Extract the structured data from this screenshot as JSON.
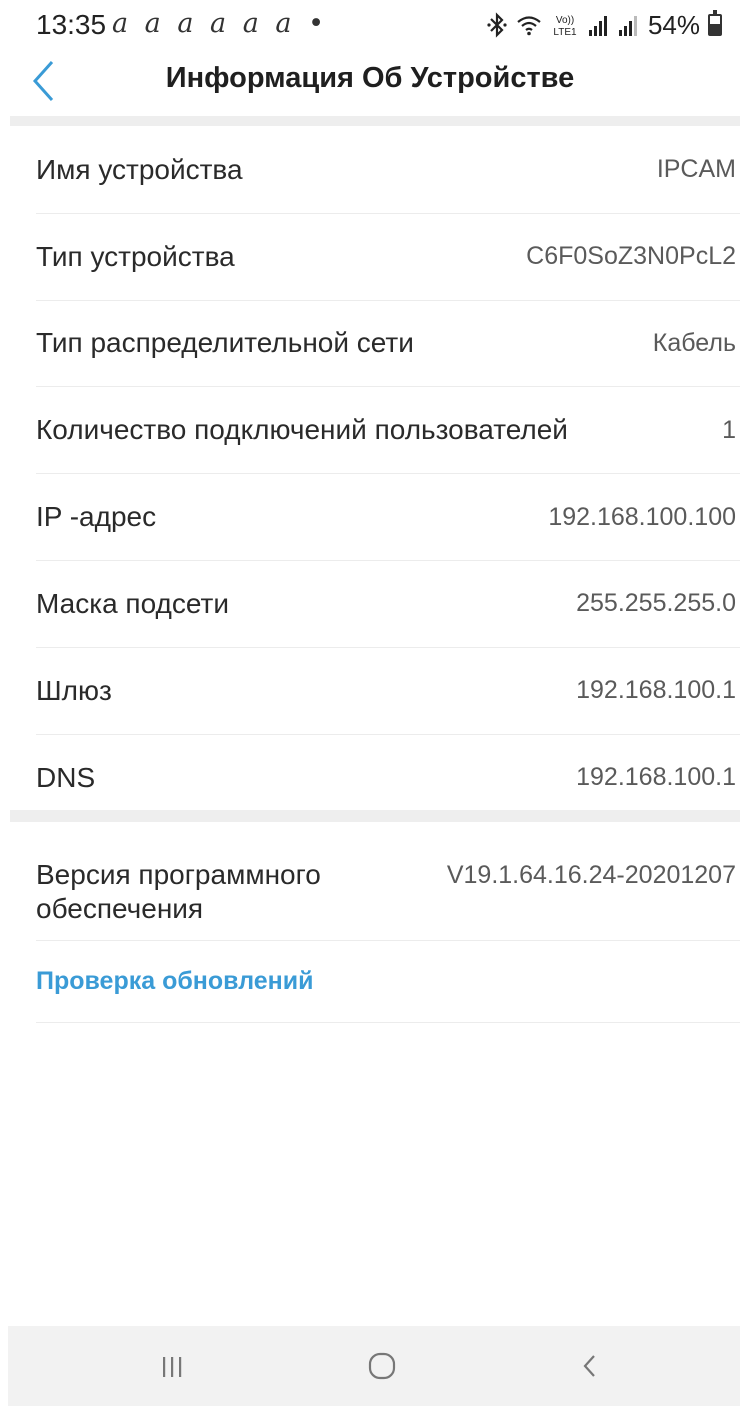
{
  "status_bar": {
    "time": "13:35",
    "notifications": "a a a a a a •",
    "battery": "54%",
    "battery_level": 0.54,
    "icons": [
      "bluetooth-icon",
      "wifi-icon",
      "volte-lte-icon",
      "signal-icon",
      "signal-icon",
      "battery-icon"
    ]
  },
  "header": {
    "title": "Информация Об Устройстве",
    "back_icon": "chevron-left-icon"
  },
  "info_rows": [
    {
      "label": "Имя устройства",
      "value": "IPCAM"
    },
    {
      "label": "Тип устройства",
      "value": "C6F0SoZ3N0PcL2"
    },
    {
      "label": "Тип распределительной сети",
      "value": "Кабель"
    },
    {
      "label": "Количество подключений пользователей",
      "value": "1"
    },
    {
      "label": "IP -адрес",
      "value": "192.168.100.100"
    },
    {
      "label": "Маска подсети",
      "value": "255.255.255.0"
    },
    {
      "label": "Шлюз",
      "value": "192.168.100.1"
    },
    {
      "label": "DNS",
      "value": "192.168.100.1"
    }
  ],
  "firmware": {
    "label": "Версия программного обеспечения",
    "value": "V19.1.64.16.24-20201207"
  },
  "update": {
    "label": "Проверка обновлений"
  },
  "nav_bar": {
    "recents_icon": "recents-icon",
    "home_icon": "home-icon",
    "back_icon": "back-icon"
  },
  "colors": {
    "accent": "#3a9bd6",
    "divider": "#eeeeee",
    "text": "#2a2a2a",
    "value_text": "#5a5a5a"
  }
}
